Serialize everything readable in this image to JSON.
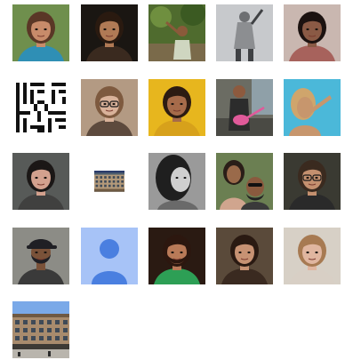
{
  "photos": [
    {
      "id": "photo-01",
      "kind": "portrait",
      "bg": "#6f8f4d",
      "skin": "#c88b6a",
      "hair": "#5a3726",
      "shirt": "#2f8fb5"
    },
    {
      "id": "photo-02",
      "kind": "portrait",
      "bg": "#1a1612",
      "skin": "#b07a55",
      "hair": "#2a1a10",
      "shirt": "#3a2a1f"
    },
    {
      "id": "photo-03",
      "kind": "outdoor",
      "bg": "#4f6b2e",
      "skin": "#8a5a3a",
      "hair": "#222222",
      "shirt": "#cfd6c0"
    },
    {
      "id": "photo-04",
      "kind": "statue",
      "bg": "#c7c9cc",
      "skin": "#6d6f72",
      "hair": "#3f4144",
      "shirt": "#8c8e91"
    },
    {
      "id": "photo-05",
      "kind": "portrait",
      "bg": "#c9b7b0",
      "skin": "#8a5a45",
      "hair": "#1c1210",
      "shirt": "#a7625c"
    },
    {
      "id": "photo-06",
      "kind": "pattern",
      "bg": "#ffffff",
      "skin": "#111111",
      "hair": "#111111",
      "shirt": "#111111"
    },
    {
      "id": "photo-07",
      "kind": "portrait-glasses",
      "bg": "#b39a83",
      "skin": "#d9b29a",
      "hair": "#7e5a3f",
      "shirt": "#5d4a3d"
    },
    {
      "id": "photo-08",
      "kind": "portrait",
      "bg": "#e7b61e",
      "skin": "#a66b4a",
      "hair": "#2c1b12",
      "shirt": "#d7a11b"
    },
    {
      "id": "photo-09",
      "kind": "guitar",
      "bg": "#6b6c63",
      "skin": "#8d5a3e",
      "hair": "#2a2a2a",
      "shirt": "#2c2c2c"
    },
    {
      "id": "photo-10",
      "kind": "portrait-blue",
      "bg": "#4bb8d9",
      "skin": "#c7966d",
      "hair": "#cfa56c",
      "shirt": "#2a9fc4"
    },
    {
      "id": "photo-11",
      "kind": "portrait",
      "bg": "#575a58",
      "skin": "#d3a18e",
      "hair": "#1b1716",
      "shirt": "#40403f"
    },
    {
      "id": "photo-12",
      "kind": "small-building",
      "bg": "#2a3c6b",
      "skin": "#b49a7a",
      "hair": "#50606e",
      "shirt": "#6e5a43"
    },
    {
      "id": "photo-13",
      "kind": "portrait-bw",
      "bg": "#9a9a9a",
      "skin": "#cfcfcf",
      "hair": "#1f1f1f",
      "shirt": "#6a6a6a"
    },
    {
      "id": "photo-14",
      "kind": "couple",
      "bg": "#6b7f52",
      "skin": "#9a6a4a",
      "hair": "#2a1e18",
      "shirt": "#d0a58e"
    },
    {
      "id": "photo-15",
      "kind": "portrait-glasses",
      "bg": "#3a3a32",
      "skin": "#c4906f",
      "hair": "#3a2a1f",
      "shirt": "#2a2a2a"
    },
    {
      "id": "photo-16",
      "kind": "portrait-cap",
      "bg": "#8c8c86",
      "skin": "#7a5239",
      "hair": "#1f1f24",
      "shirt": "#3a3a3a"
    },
    {
      "id": "photo-17",
      "kind": "default-avatar",
      "bg": "#a7c3f7",
      "skin": "#4a7fe0",
      "hair": "#4a7fe0",
      "shirt": "#4a7fe0"
    },
    {
      "id": "photo-18",
      "kind": "portrait-beard",
      "bg": "#2a1a12",
      "skin": "#b97a58",
      "hair": "#2c170f",
      "shirt": "#2d9f55"
    },
    {
      "id": "photo-19",
      "kind": "portrait",
      "bg": "#5a4a3a",
      "skin": "#c79273",
      "hair": "#2a1a12",
      "shirt": "#3a2a20"
    },
    {
      "id": "photo-20",
      "kind": "portrait",
      "bg": "#d7d0c6",
      "skin": "#e0b6a0",
      "hair": "#a77a52",
      "shirt": "#d8cfc5"
    },
    {
      "id": "photo-21",
      "kind": "building",
      "bg": "#7aa9e8",
      "skin": "#a88b6d",
      "hair": "#6f5943",
      "shirt": "#3d3a35"
    }
  ]
}
